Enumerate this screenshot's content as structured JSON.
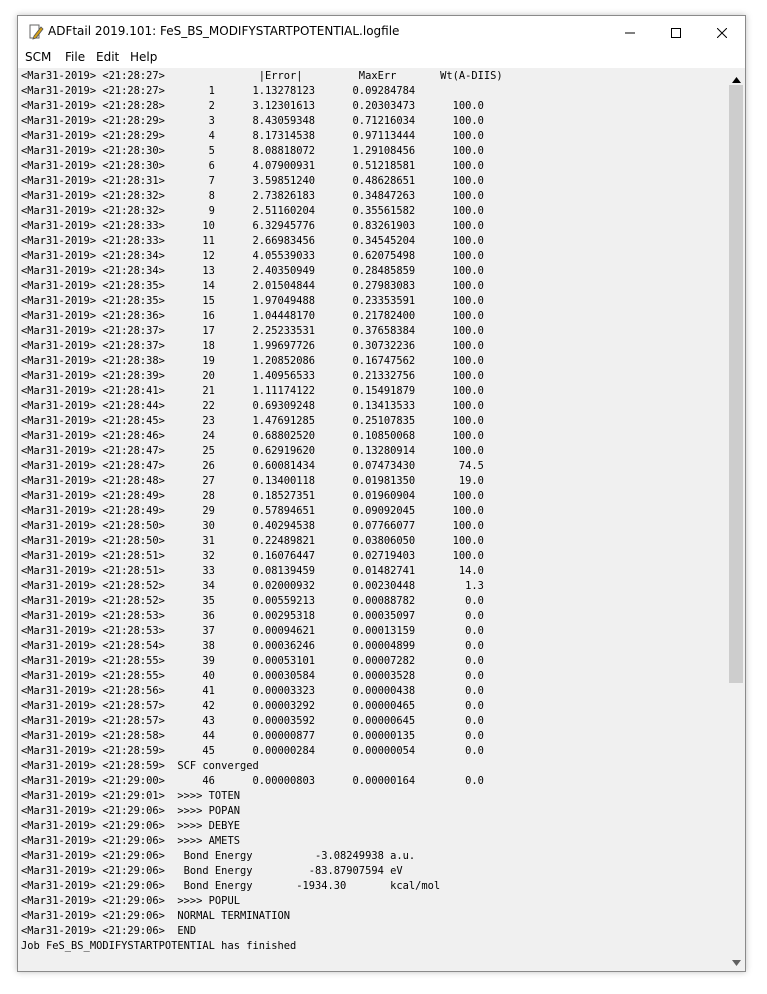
{
  "window": {
    "title": "ADFtail 2019.101: FeS_BS_MODIFYSTARTPOTENTIAL.logfile",
    "app_icon": "pen-icon",
    "controls": [
      "minimize-icon",
      "maximize-icon",
      "close-icon"
    ]
  },
  "menu": [
    "SCM",
    "File",
    "Edit",
    "Help"
  ],
  "log_lines": [
    "<Mar31-2019> <21:28:27>               |Error|         MaxErr       Wt(A-DIIS)",
    "<Mar31-2019> <21:28:27>       1      1.13278123      0.09284784",
    "<Mar31-2019> <21:28:28>       2      3.12301613      0.20303473      100.0",
    "<Mar31-2019> <21:28:29>       3      8.43059348      0.71216034      100.0",
    "<Mar31-2019> <21:28:29>       4      8.17314538      0.97113444      100.0",
    "<Mar31-2019> <21:28:30>       5      8.08818072      1.29108456      100.0",
    "<Mar31-2019> <21:28:30>       6      4.07900931      0.51218581      100.0",
    "<Mar31-2019> <21:28:31>       7      3.59851240      0.48628651      100.0",
    "<Mar31-2019> <21:28:32>       8      2.73826183      0.34847263      100.0",
    "<Mar31-2019> <21:28:32>       9      2.51160204      0.35561582      100.0",
    "<Mar31-2019> <21:28:33>      10      6.32945776      0.83261903      100.0",
    "<Mar31-2019> <21:28:33>      11      2.66983456      0.34545204      100.0",
    "<Mar31-2019> <21:28:34>      12      4.05539033      0.62075498      100.0",
    "<Mar31-2019> <21:28:34>      13      2.40350949      0.28485859      100.0",
    "<Mar31-2019> <21:28:35>      14      2.01504844      0.27983083      100.0",
    "<Mar31-2019> <21:28:35>      15      1.97049488      0.23353591      100.0",
    "<Mar31-2019> <21:28:36>      16      1.04448170      0.21782400      100.0",
    "<Mar31-2019> <21:28:37>      17      2.25233531      0.37658384      100.0",
    "<Mar31-2019> <21:28:37>      18      1.99697726      0.30732236      100.0",
    "<Mar31-2019> <21:28:38>      19      1.20852086      0.16747562      100.0",
    "<Mar31-2019> <21:28:39>      20      1.40956533      0.21332756      100.0",
    "<Mar31-2019> <21:28:41>      21      1.11174122      0.15491879      100.0",
    "<Mar31-2019> <21:28:44>      22      0.69309248      0.13413533      100.0",
    "<Mar31-2019> <21:28:45>      23      1.47691285      0.25107835      100.0",
    "<Mar31-2019> <21:28:46>      24      0.68802520      0.10850068      100.0",
    "<Mar31-2019> <21:28:47>      25      0.62919620      0.13280914      100.0",
    "<Mar31-2019> <21:28:47>      26      0.60081434      0.07473430       74.5",
    "<Mar31-2019> <21:28:48>      27      0.13400118      0.01981350       19.0",
    "<Mar31-2019> <21:28:49>      28      0.18527351      0.01960904      100.0",
    "<Mar31-2019> <21:28:49>      29      0.57894651      0.09092045      100.0",
    "<Mar31-2019> <21:28:50>      30      0.40294538      0.07766077      100.0",
    "<Mar31-2019> <21:28:50>      31      0.22489821      0.03806050      100.0",
    "<Mar31-2019> <21:28:51>      32      0.16076447      0.02719403      100.0",
    "<Mar31-2019> <21:28:51>      33      0.08139459      0.01482741       14.0",
    "<Mar31-2019> <21:28:52>      34      0.02000932      0.00230448        1.3",
    "<Mar31-2019> <21:28:52>      35      0.00559213      0.00088782        0.0",
    "<Mar31-2019> <21:28:53>      36      0.00295318      0.00035097        0.0",
    "<Mar31-2019> <21:28:53>      37      0.00094621      0.00013159        0.0",
    "<Mar31-2019> <21:28:54>      38      0.00036246      0.00004899        0.0",
    "<Mar31-2019> <21:28:55>      39      0.00053101      0.00007282        0.0",
    "<Mar31-2019> <21:28:55>      40      0.00030584      0.00003528        0.0",
    "<Mar31-2019> <21:28:56>      41      0.00003323      0.00000438        0.0",
    "<Mar31-2019> <21:28:57>      42      0.00003292      0.00000465        0.0",
    "<Mar31-2019> <21:28:57>      43      0.00003592      0.00000645        0.0",
    "<Mar31-2019> <21:28:58>      44      0.00000877      0.00000135        0.0",
    "<Mar31-2019> <21:28:59>      45      0.00000284      0.00000054        0.0",
    "<Mar31-2019> <21:28:59>  SCF converged",
    "<Mar31-2019> <21:29:00>      46      0.00000803      0.00000164        0.0",
    "<Mar31-2019> <21:29:01>  >>>> TOTEN",
    "<Mar31-2019> <21:29:06>  >>>> POPAN",
    "<Mar31-2019> <21:29:06>  >>>> DEBYE",
    "<Mar31-2019> <21:29:06>  >>>> AMETS",
    "<Mar31-2019> <21:29:06>   Bond Energy          -3.08249938 a.u.",
    "<Mar31-2019> <21:29:06>   Bond Energy         -83.87907594 eV",
    "<Mar31-2019> <21:29:06>   Bond Energy       -1934.30       kcal/mol",
    "<Mar31-2019> <21:29:06>  >>>> POPUL",
    "<Mar31-2019> <21:29:06>  NORMAL TERMINATION",
    "<Mar31-2019> <21:29:06>  END",
    "Job FeS_BS_MODIFYSTARTPOTENTIAL has finished"
  ],
  "scrollbar": {
    "up_icon": "scroll-up-arrow-icon",
    "down_icon": "scroll-down-arrow-icon"
  }
}
